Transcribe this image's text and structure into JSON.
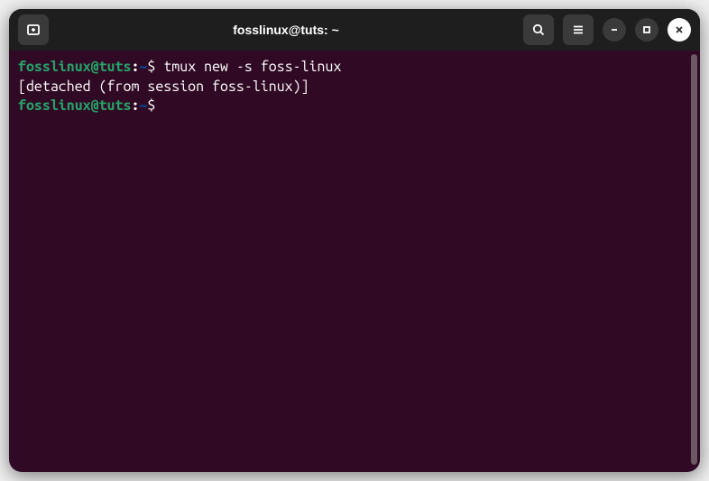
{
  "window": {
    "title": "fosslinux@tuts: ~"
  },
  "icons": {
    "new_tab": "new-tab-icon",
    "search": "search-icon",
    "menu": "menu-icon",
    "minimize": "minimize-icon",
    "maximize": "maximize-icon",
    "close": "close-icon"
  },
  "terminal": {
    "lines": [
      {
        "prompt_user": "fosslinux@tuts",
        "prompt_colon": ":",
        "prompt_path": "~",
        "prompt_symbol": "$ ",
        "command": "tmux new -s foss-linux"
      },
      {
        "output": "[detached (from session foss-linux)]"
      },
      {
        "prompt_user": "fosslinux@tuts",
        "prompt_colon": ":",
        "prompt_path": "~",
        "prompt_symbol": "$ ",
        "command": ""
      }
    ]
  }
}
